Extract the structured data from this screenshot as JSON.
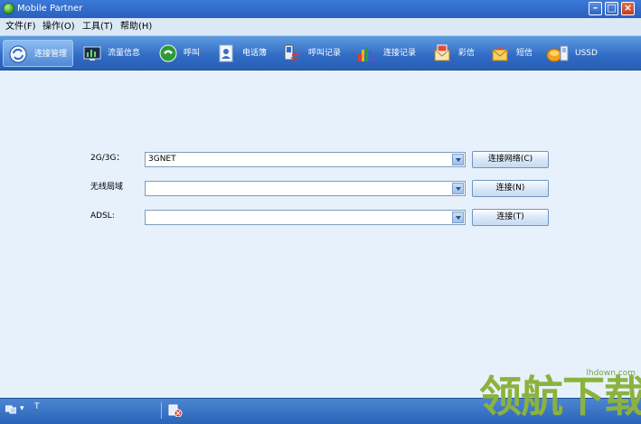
{
  "window": {
    "title": "Mobile Partner"
  },
  "menu": [
    {
      "label": "文件(F)"
    },
    {
      "label": "操作(O)"
    },
    {
      "label": "工具(T)"
    },
    {
      "label": "帮助(H)"
    }
  ],
  "toolbar": [
    {
      "label": "连接管理",
      "icon": "connection-manage-icon",
      "active": true
    },
    {
      "label": "流量信息",
      "icon": "traffic-info-icon"
    },
    {
      "label": "呼叫",
      "icon": "call-icon"
    },
    {
      "label": "电话簿",
      "icon": "phonebook-icon"
    },
    {
      "label": "呼叫记录",
      "icon": "call-log-icon"
    },
    {
      "label": "连接记录",
      "icon": "connection-log-icon"
    },
    {
      "label": "彩信",
      "icon": "mms-icon"
    },
    {
      "label": "短信",
      "icon": "sms-icon"
    },
    {
      "label": "USSD",
      "icon": "ussd-icon"
    }
  ],
  "connections": [
    {
      "label": "2G/3G：",
      "value": "3GNET",
      "button": "连接网络(C)"
    },
    {
      "label": "无线局域",
      "value": "",
      "button": "连接(N)"
    },
    {
      "label": "ADSL:",
      "value": "",
      "button": "连接(T)"
    }
  ],
  "status": {
    "dropdown": "▾",
    "signal": "T"
  },
  "watermark": {
    "text": "领航下载",
    "url": "lhdown.com"
  },
  "colors": {
    "titlebar": "#2a5fbf",
    "toolbar": "#2f6ac4",
    "background": "#e6f1fb",
    "watermark": "#8cb23e"
  }
}
